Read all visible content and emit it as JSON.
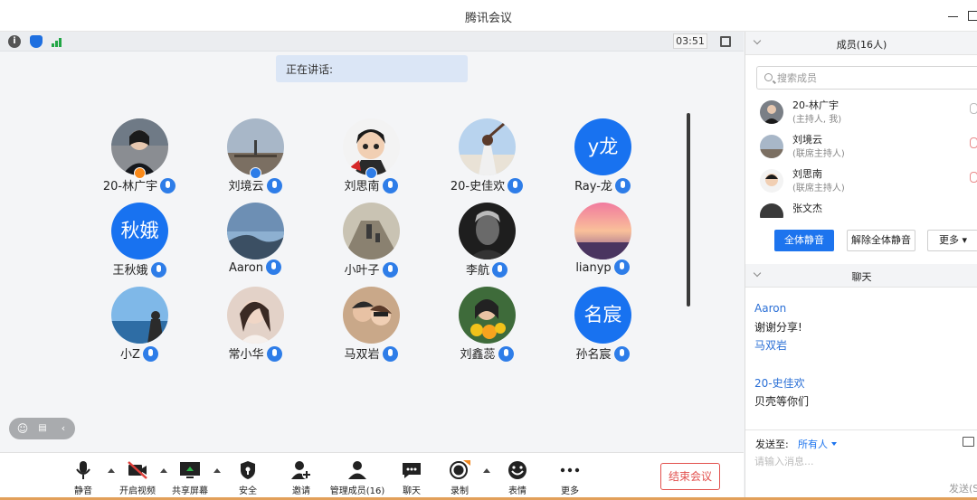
{
  "window": {
    "title": "腾讯会议"
  },
  "topbar": {
    "timer": "03:51"
  },
  "speaking": {
    "label": "正在讲话:"
  },
  "participants": [
    {
      "name": "20-林广宇",
      "role": "host"
    },
    {
      "name": "刘境云",
      "role": "cohost"
    },
    {
      "name": "刘思南",
      "role": "cohost"
    },
    {
      "name": "20-史佳欢"
    },
    {
      "name": "Ray-龙",
      "avatar_text": "y龙"
    },
    {
      "name": "王秋娥",
      "avatar_text": "秋娥"
    },
    {
      "name": "Aaron"
    },
    {
      "name": "小叶子"
    },
    {
      "name": "李航"
    },
    {
      "name": "lianyp"
    },
    {
      "name": "小Z"
    },
    {
      "name": "常小华"
    },
    {
      "name": "马双岩"
    },
    {
      "name": "刘鑫蕊"
    },
    {
      "name": "孙名宸",
      "avatar_text": "名宸"
    }
  ],
  "toolbar": {
    "mute": "静音",
    "video": "开启视频",
    "share": "共享屏幕",
    "security": "安全",
    "invite": "邀请",
    "manage": "管理成员(16)",
    "chat": "聊天",
    "record": "录制",
    "emoji": "表情",
    "more": "更多",
    "end": "结束会议"
  },
  "members_panel": {
    "title": "成员(16人)",
    "search_placeholder": "搜索成员",
    "members": [
      {
        "name": "20-林广宇",
        "role": "(主持人, 我)"
      },
      {
        "name": "刘境云",
        "role": "(联席主持人)"
      },
      {
        "name": "刘思南",
        "role": "(联席主持人)"
      },
      {
        "name": "张文杰",
        "role": ""
      }
    ],
    "mute_all": "全体静音",
    "unmute_all": "解除全体静音",
    "more": "更多"
  },
  "chat_panel": {
    "title": "聊天",
    "messages": [
      {
        "sender": "Aaron",
        "text": "谢谢分享!"
      },
      {
        "sender": "马双岩",
        "text": ""
      },
      {
        "sender": "20-史佳欢",
        "text": "贝壳等你们"
      }
    ],
    "send_to_label": "发送至:",
    "send_to_value": "所有人",
    "input_placeholder": "请输入消息...",
    "send_label": "发送(S"
  },
  "colors": {
    "accent": "#1d74ee",
    "end": "#e2504d",
    "host": "#fa8a1a"
  }
}
